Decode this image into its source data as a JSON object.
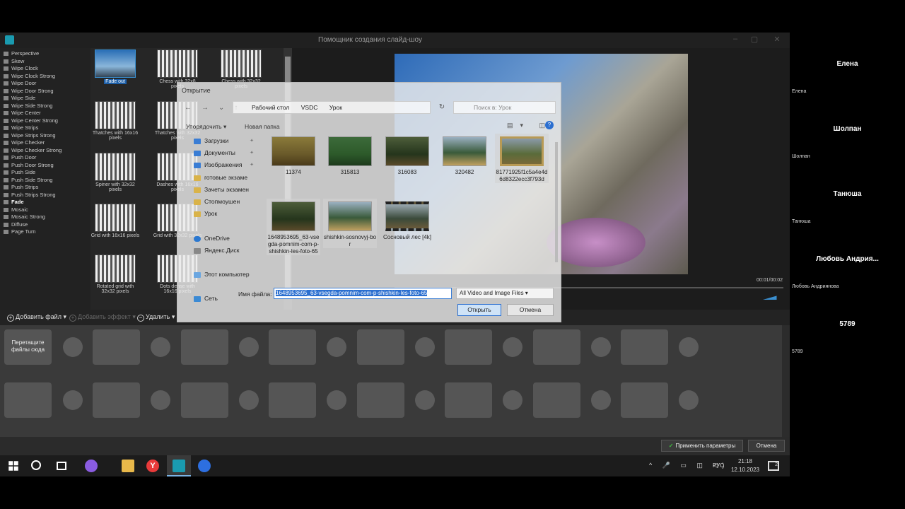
{
  "app": {
    "title": "Помощник создания слайд-шоу",
    "controls": [
      "–",
      "▢",
      "✕"
    ]
  },
  "effects": [
    "Perspective",
    "Skew",
    "Wipe Clock",
    "Wipe Clock Strong",
    "Wipe Door",
    "Wipe Door Strong",
    "Wipe Side",
    "Wipe Side Strong",
    "Wipe Center",
    "Wipe Center Strong",
    "Wipe Strips",
    "Wipe Strips Strong",
    "Wipe Checker",
    "Wipe Checker Strong",
    "Push Door",
    "Push Door Strong",
    "Push Side",
    "Push Side Strong",
    "Push Strips",
    "Push Strips Strong",
    "Fade",
    "Mosaic",
    "Mosaic Strong",
    "Diffuse",
    "Page Turn"
  ],
  "effects_active": "Fade",
  "thumbs": {
    "fade_out": "Fade out",
    "chess": "Chess with 32x8 pixels",
    "chess2": "Chess with 32x32 pixels",
    "thatches16": "Thatches with 16x16 pixels",
    "thatches32": "Thatches with 32x32 pixels",
    "spiner": "Spiner with 32x32 pixels",
    "dashes": "Dashes with 16x16 pixels",
    "grid16": "Grid with 16x16 pixels",
    "grid32": "Grid with 32x32 pixels",
    "rotated": "Rotated grid with 32x32 pixels",
    "dots": "Dots dense with 16x16 pixels"
  },
  "preview": {
    "time": "00:01/00:02"
  },
  "toolbar": {
    "add_file": "Добавить файл",
    "add_effect": "Добавить эффект",
    "delete": "Удалить"
  },
  "storyboard": {
    "drop_hint": "Перетащите файлы сюда"
  },
  "bottom": {
    "apply": "Применить параметры",
    "cancel": "Отмена"
  },
  "dialog": {
    "title": "Открытие",
    "path": [
      "Рабочий стол",
      "VSDC",
      "Урок"
    ],
    "search_placeholder": "Поиск в: Урок",
    "organize": "Упорядочить ▾",
    "new_folder": "Новая папка",
    "nav": [
      {
        "label": "Загрузки",
        "icon": "download-folder-icon",
        "pinned": true
      },
      {
        "label": "Документы",
        "icon": "documents-folder-icon",
        "pinned": true
      },
      {
        "label": "Изображения",
        "icon": "pictures-folder-icon",
        "pinned": true
      },
      {
        "label": "готовые экзаме",
        "icon": "folder-icon",
        "pinned": false
      },
      {
        "label": "Зачеты экзамен",
        "icon": "folder-icon",
        "pinned": false
      },
      {
        "label": "Стопмоушен",
        "icon": "folder-icon",
        "pinned": false
      },
      {
        "label": "Урок",
        "icon": "folder-icon",
        "pinned": false
      },
      {
        "label": "",
        "icon": "",
        "pinned": false
      },
      {
        "label": "OneDrive",
        "icon": "onedrive-icon",
        "pinned": false
      },
      {
        "label": "Яндекс.Диск",
        "icon": "yandex-disk-icon",
        "pinned": false
      },
      {
        "label": "",
        "icon": "",
        "pinned": false
      },
      {
        "label": "Этот компьютер",
        "icon": "this-pc-icon",
        "pinned": false
      },
      {
        "label": "",
        "icon": "",
        "pinned": false
      },
      {
        "label": "Сеть",
        "icon": "network-icon",
        "pinned": false
      }
    ],
    "files": [
      {
        "name": "11374",
        "thumb": "autumn"
      },
      {
        "name": "315813",
        "thumb": "green"
      },
      {
        "name": "316083",
        "thumb": "forest"
      },
      {
        "name": "320482",
        "thumb": "pine"
      },
      {
        "name": "81771925f1c5a4e4d6d8322ecc3f793d",
        "thumb": "gold"
      },
      {
        "name": "1648953695_63-vsegda-pomnim-com-p-shishkin-les-foto-65",
        "thumb": "forest"
      },
      {
        "name": "shishkin-sosnovyj-bor",
        "thumb": "pine"
      },
      {
        "name": "Сосновый лес [4k]",
        "thumb": "video"
      }
    ],
    "filename_label": "Имя файла:",
    "filename_value": "1648953695_63-vsegda-pomnim-com-p-shishkin-les-foto-65",
    "filter": "All Video and Image Files",
    "open": "Открыть",
    "cancel": "Отмена"
  },
  "people": [
    {
      "big": "Елена",
      "small": "Елена"
    },
    {
      "big": "Шолпан",
      "small": "Шолпан"
    },
    {
      "big": "Танюша",
      "small": "Танюша"
    },
    {
      "big": "Любовь Андрия...",
      "small": "Любовь Андриянова"
    },
    {
      "big": "5789",
      "small": "5789"
    }
  ],
  "taskbar": {
    "lang": "РУС",
    "time": "21:18",
    "date": "12.10.2023",
    "yandex_letter": "Y",
    "tray_icons": "^ 🎤 ▭ ◫ ◁)",
    "notif_count": "2"
  }
}
